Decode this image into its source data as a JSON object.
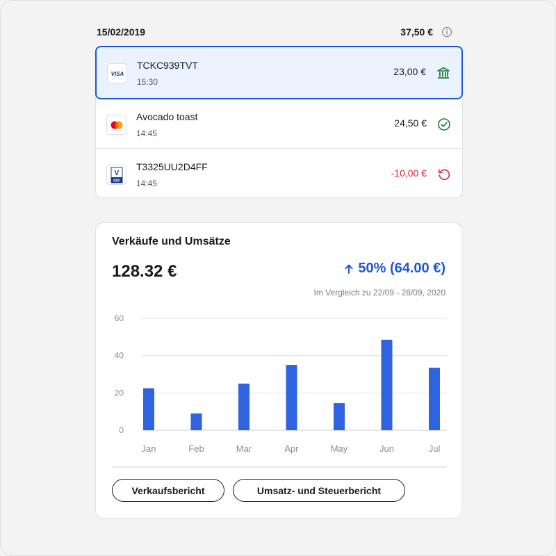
{
  "day": {
    "date": "15/02/2019",
    "total": "37,50 €"
  },
  "transactions": [
    {
      "card": "VISA",
      "title": "TCKC939TVT",
      "time": "15:30",
      "amount": "23,00 €",
      "status": "bank-icon",
      "negative": false
    },
    {
      "card": "mastercard",
      "title": "Avocado toast",
      "time": "14:45",
      "amount": "24,50 €",
      "status": "check-circle-icon",
      "negative": false
    },
    {
      "card": "V PAY",
      "title": "T3325UU2D4FF",
      "time": "14:45",
      "amount": "-10,00 €",
      "status": "refund-icon",
      "negative": true
    }
  ],
  "sales": {
    "title": "Verkäufe und Umsätze",
    "total": "128.32 €",
    "change": "50% (64.00 €)",
    "compare": "Im Vergleich zu 22/09 - 28/09, 2020"
  },
  "chart_data": {
    "type": "bar",
    "categories": [
      "Jan",
      "Feb",
      "Mar",
      "Apr",
      "May",
      "Jun",
      "Jul"
    ],
    "values": [
      22.5,
      9,
      25,
      35,
      14.5,
      48.5,
      33.5
    ],
    "y_ticks": [
      "0",
      "20",
      "40",
      "60"
    ],
    "ylim": [
      0,
      60
    ],
    "grid": true,
    "color": "#2f63e0"
  },
  "buttons": {
    "sales_report": "Verkaufsbericht",
    "tax_report": "Umsatz- und Steuerbericht"
  },
  "colors": {
    "accent": "#1f57d6",
    "negative": "#d2263a",
    "success": "#1d7a3a",
    "bank": "#1d7a3a"
  }
}
